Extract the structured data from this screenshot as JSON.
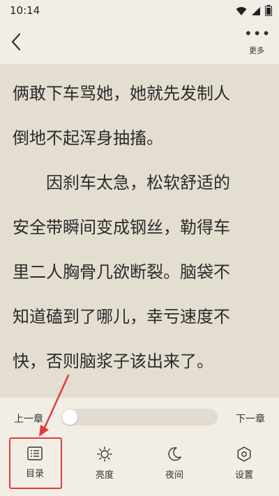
{
  "status": {
    "time": "10:14",
    "icons": [
      "wifi-icon",
      "signal-icon",
      "battery-icon"
    ]
  },
  "header": {
    "more_label": "更多"
  },
  "reader": {
    "paragraphs": [
      {
        "lines": [
          "俩敢下车骂她，她就先发制人",
          "倒地不起浑身抽搐。"
        ],
        "indent": false
      },
      {
        "lines": [
          "因刹车太急，松软舒适的",
          "安全带瞬间变成钢丝，勒得车",
          "里二人胸骨几欲断裂。脑袋不",
          "知道磕到了哪儿，幸亏速度不",
          "快，否则脑浆子该出来了。"
        ],
        "indent": true
      }
    ]
  },
  "controls": {
    "prev_chapter": "上一章",
    "next_chapter": "下一章",
    "progress": 0.0,
    "tools": [
      {
        "label": "目录",
        "icon": "list-icon"
      },
      {
        "label": "亮度",
        "icon": "brightness-icon"
      },
      {
        "label": "夜间",
        "icon": "moon-icon"
      },
      {
        "label": "设置",
        "icon": "settings-icon"
      }
    ]
  },
  "colors": {
    "annotation": "#e23b3b",
    "reading_bg": "#e4ded1",
    "panel_bg": "#f2eee6"
  }
}
